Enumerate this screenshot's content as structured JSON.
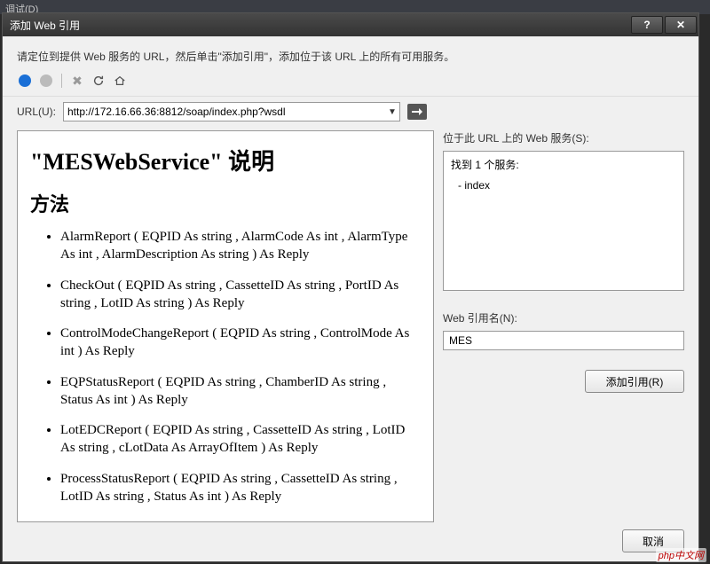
{
  "background": {
    "menu_fragment": "调试(D)"
  },
  "dialog": {
    "title": "添加 Web 引用",
    "instruction": "请定位到提供 Web 服务的 URL，然后单击\"添加引用\"，添加位于该 URL 上的所有可用服务。"
  },
  "toolbar": {
    "back_name": "back-icon",
    "forward_name": "forward-icon",
    "stop_name": "stop-icon",
    "refresh_name": "refresh-icon",
    "home_name": "home-icon"
  },
  "url": {
    "label": "URL(U):",
    "value": "http://172.16.66.36:8812/soap/index.php?wsdl"
  },
  "preview": {
    "title": "\"MESWebService\" 说明",
    "section": "方法",
    "methods": [
      "AlarmReport ( EQPID As string ,  AlarmCode As int ,  AlarmType As int ,  AlarmDescription As string ) As Reply",
      "CheckOut ( EQPID As string ,  CassetteID As string ,  PortID As string ,  LotID As string ) As Reply",
      "ControlModeChangeReport ( EQPID As string ,  ControlMode As int ) As Reply",
      "EQPStatusReport ( EQPID As string ,  ChamberID As string ,  Status As int ) As Reply",
      "LotEDCReport ( EQPID As string ,  CassetteID As string ,  LotID As string ,  cLotData As ArrayOfItem ) As Reply",
      "ProcessStatusReport ( EQPID As string ,  CassetteID As string ,  LotID As string ,  Status As int ) As Reply"
    ]
  },
  "services": {
    "panel_label": "位于此 URL 上的 Web 服务(S):",
    "found_text": "找到 1 个服务:",
    "items": [
      "- index"
    ]
  },
  "reference": {
    "label": "Web 引用名(N):",
    "value": "MES"
  },
  "buttons": {
    "add_reference": "添加引用(R)",
    "cancel": "取消"
  },
  "watermark": "php中文网"
}
